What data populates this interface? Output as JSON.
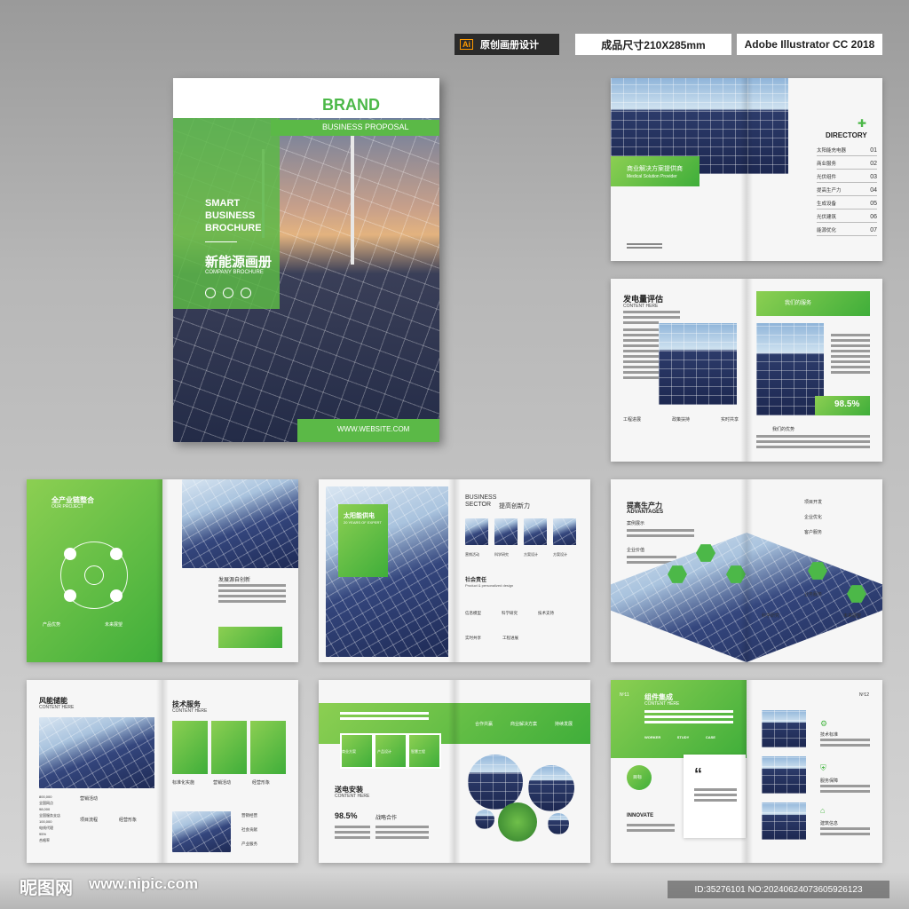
{
  "top_bar": {
    "ai_badge": "Ai",
    "item1": "原创画册设计",
    "item2": "成品尺寸210X285mm",
    "item3": "Adobe Illustrator CC 2018"
  },
  "cover": {
    "brand": "BRAND",
    "subtitle": "BUSINESS PROPOSAL",
    "title_en_1": "SMART",
    "title_en_2": "BUSINESS",
    "title_en_3": "BROCHURE",
    "title_cn": "新能源画册",
    "company": "COMPANY BROCHURE",
    "website": "WWW.WEBSITE.COM"
  },
  "directory": {
    "heading": "DIRECTORY",
    "banner_cn": "商业解决方案提供商",
    "banner_en": "Medical Solution Provider",
    "items": [
      {
        "label": "太阳能充电器",
        "num": "01"
      },
      {
        "label": "商业服务",
        "num": "02"
      },
      {
        "label": "光伏组件",
        "num": "03"
      },
      {
        "label": "提高生产力",
        "num": "04"
      },
      {
        "label": "生成设备",
        "num": "05"
      },
      {
        "label": "光伏建筑",
        "num": "06"
      },
      {
        "label": "能源优化",
        "num": "07"
      }
    ]
  },
  "p2": {
    "title": "发电量评估",
    "content": "CONTENT HERE",
    "service": "我们的服务",
    "percent": "98.5%",
    "labels": [
      "工程进展",
      "政策扶持",
      "实时共享"
    ],
    "advantage": "我们的优势"
  },
  "p3": {
    "title": "全产业链整合",
    "project": "OUR PROJECT",
    "label1": "产品优势",
    "label2": "未来展望",
    "sub": "发展源自创新"
  },
  "p4": {
    "solar": "太阳能供电",
    "years": "20 YEARS OF EXPERT",
    "business": "BUSINESS",
    "sector": "SECTOR",
    "power": "提高创新力",
    "thumbs": [
      "营销活动",
      "科学研究",
      "方案设计",
      "方案设计"
    ],
    "social": "社会责任",
    "social_en": "Product & personalized design",
    "row2": [
      "信息模型",
      "科学研究",
      "技术支持"
    ],
    "row3": [
      "实时共享",
      "工程进展"
    ]
  },
  "p5": {
    "title": "提高生产力",
    "advantages": "ADVANTAGES",
    "cases": "案例展示",
    "company": "企业价值",
    "right": [
      "项目开发",
      "企业优化",
      "客户服务"
    ],
    "items": [
      "技术支持",
      "服务保障",
      "科学研究",
      "业务服务",
      "未来展望"
    ]
  },
  "p6": {
    "title": "风能储能",
    "content": "CONTENT HERE",
    "service": "技术服务",
    "service_content": "CONTENT HERE",
    "stats": [
      "800,000",
      "全国网点",
      "98,000",
      "全国服务支店",
      "100,000",
      "电线代理",
      "95%",
      "合格率"
    ],
    "labels": [
      "营销活动",
      "项目流程",
      "经营形象"
    ],
    "boxes": [
      "标准化实施",
      "营销活动",
      "经营形象"
    ],
    "right_items": [
      "营销经营",
      "社会贡献",
      "产业服务"
    ]
  },
  "p7": {
    "title": "送电安装",
    "content": "CONTENT HERE",
    "percent": "98.5%",
    "partner": "战略合作",
    "circles": [
      "合作共赢",
      "商业解决方案",
      "持续发展"
    ],
    "boxes": [
      "商业方案",
      "产品设计",
      "智慧工程"
    ]
  },
  "p8": {
    "num1": "Nº11",
    "title": "组件集成",
    "content": "CONTENT HERE",
    "tabs": [
      "WORKER",
      "STUDY",
      "CASE"
    ],
    "circle": "目标",
    "innovate": "INNOVATE",
    "num2": "Nº12",
    "items": [
      "技术标准",
      "服务保障",
      "建筑信息"
    ]
  },
  "watermark": {
    "logo": "昵图网",
    "url": "www.nipic.com",
    "id": "ID:35276101 NO:20240624073605926123"
  },
  "colors": {
    "accent": "#4cb848",
    "accent_light": "#8ccf52"
  }
}
